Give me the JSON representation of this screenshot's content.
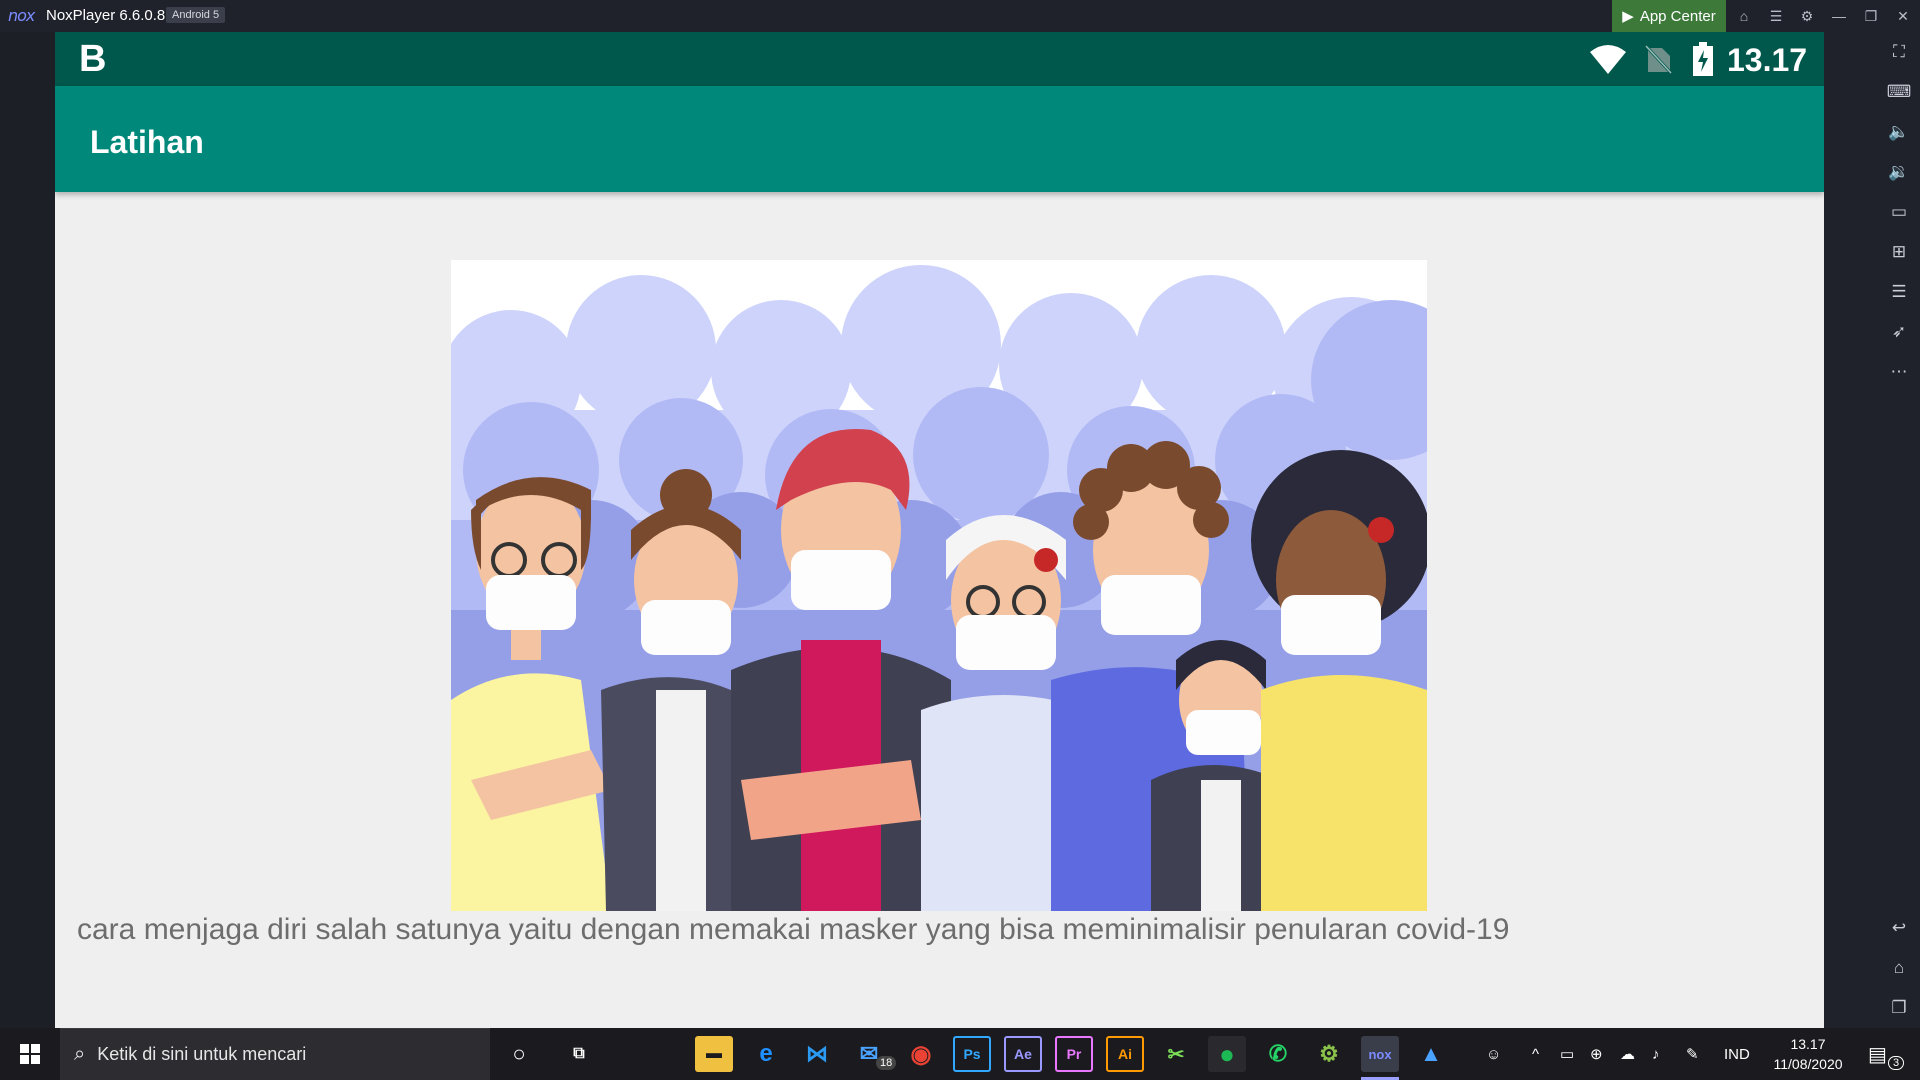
{
  "window": {
    "app_title": "NoxPlayer 6.6.0.8",
    "android_badge": "Android 5",
    "logo_text": "nox",
    "app_center_label": "App Center"
  },
  "android": {
    "status_logo": "B",
    "status_time": "13.17",
    "toolbar_title": "Latihan",
    "caption": "cara menjaga diri salah satunya yaitu dengan memakai masker yang bisa meminimalisir penularan covid-19"
  },
  "taskbar": {
    "search_placeholder": "Ketik di sini untuk mencari",
    "mail_badge": "18",
    "language": "IND",
    "clock_time": "13.17",
    "clock_date": "11/08/2020",
    "notification_count": "3"
  },
  "colors": {
    "status_bar": "#00574b",
    "app_bar": "#00897b",
    "app_center": "#3d7a3a"
  }
}
